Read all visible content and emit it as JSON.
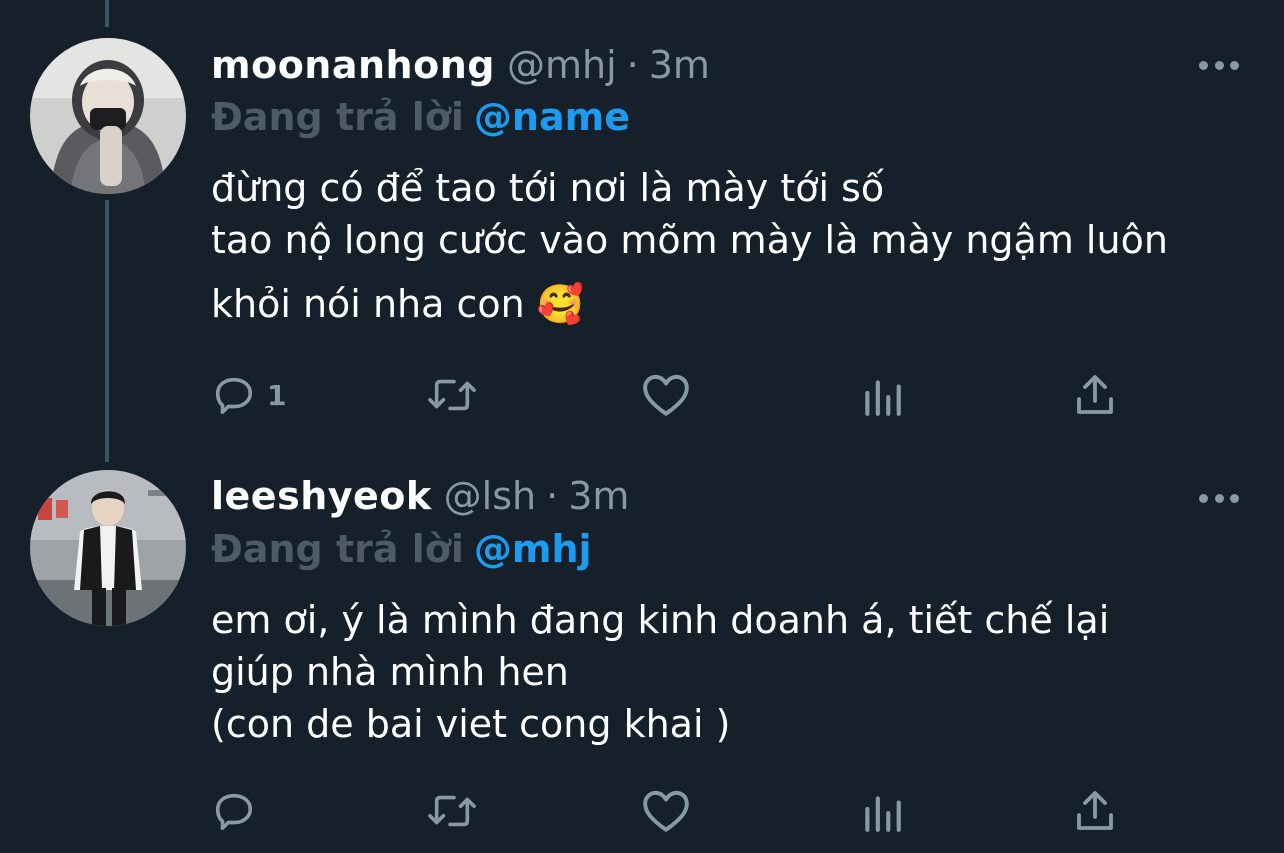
{
  "tweets": [
    {
      "display_name": "moonanhong",
      "handle": "@mhj",
      "separator": "·",
      "time": "3m",
      "replying_label": "Đang trả lời",
      "replying_to": "@name",
      "lines": [
        "đừng có để tao tới nơi là mày tới số",
        "tao nộ long cước vào mõm mày là mày ngậm luôn",
        "khỏi nói nha con 🥰"
      ],
      "reply_count": "1",
      "retweet_count": "",
      "like_count": ""
    },
    {
      "display_name": "leeshyeok",
      "handle": "@lsh",
      "separator": "·",
      "time": "3m",
      "replying_label": "Đang trả lời",
      "replying_to": "@mhj",
      "lines": [
        "em ơi, ý là mình đang kinh doanh á, tiết chế lại",
        "giúp nhà mình hen",
        "(con de bai viet cong khai )"
      ],
      "reply_count": "",
      "retweet_count": "",
      "like_count": ""
    }
  ],
  "icons": {
    "reply": "reply-icon",
    "retweet": "retweet-icon",
    "like": "heart-icon",
    "analytics": "analytics-icon",
    "share": "share-icon",
    "more": "more-icon"
  },
  "colors": {
    "background": "#15202b",
    "text_primary": "#ffffff",
    "text_secondary": "#8899a6",
    "accent": "#1d9bf0",
    "thread_line": "#3d5466"
  }
}
